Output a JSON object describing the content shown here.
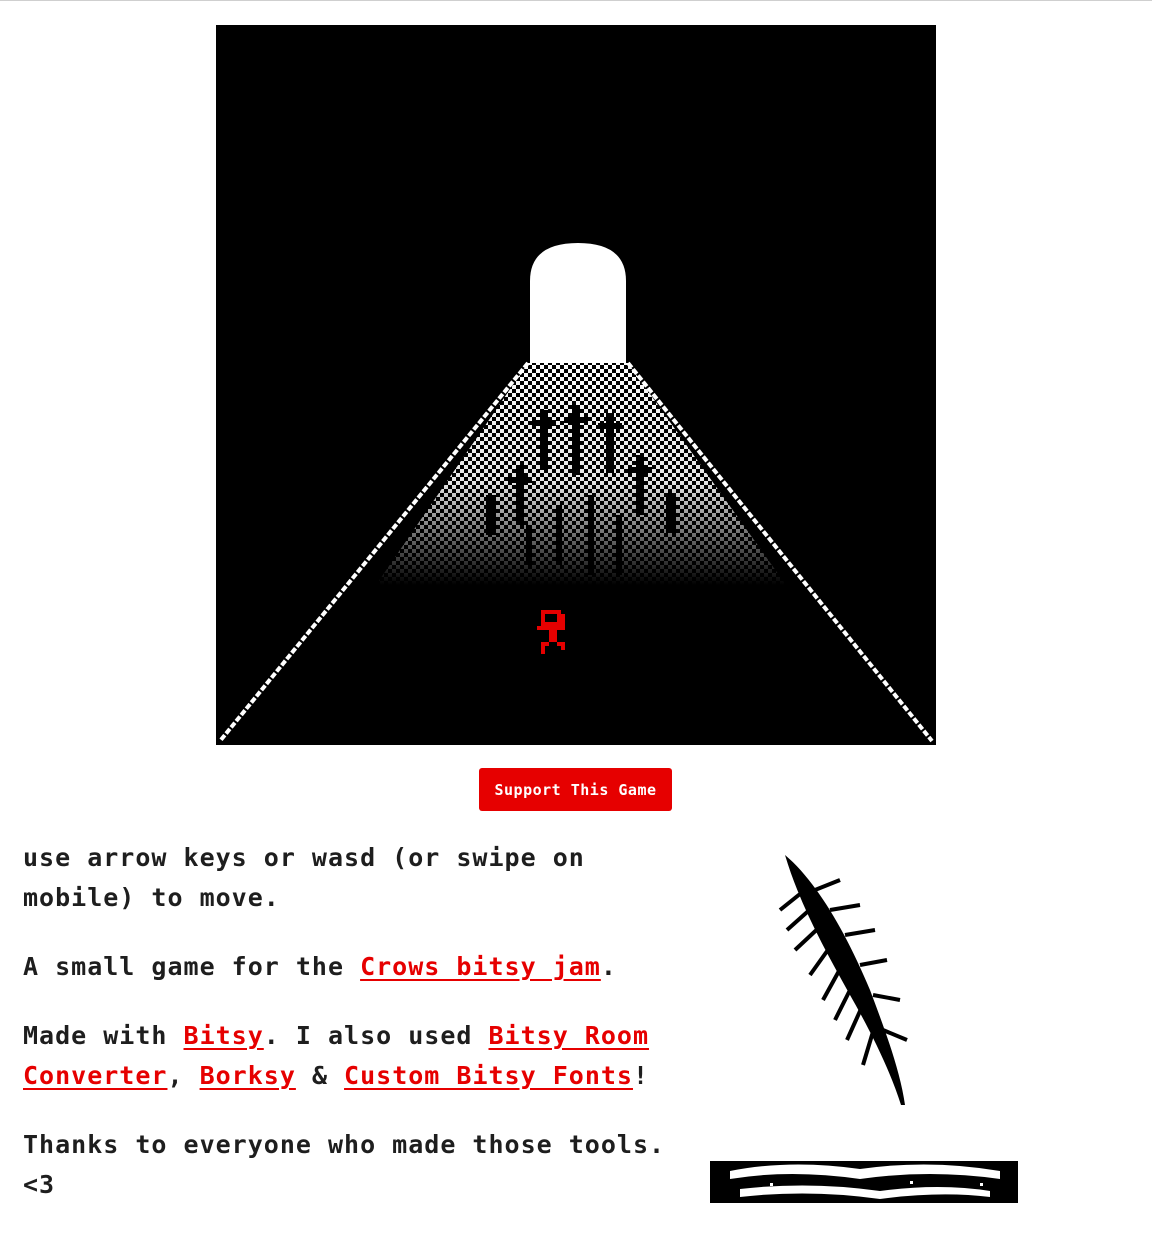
{
  "button": {
    "support_label": "Support This Game"
  },
  "description": {
    "line1": "use arrow keys or wasd (or swipe on mobile) to move.",
    "p2_prefix": "A small game for the ",
    "p2_link": "Crows bitsy jam",
    "p2_suffix": ".",
    "p3_prefix": "Made with ",
    "p3_link1": "Bitsy",
    "p3_mid1": ". I also used ",
    "p3_link2": "Bitsy Room Converter",
    "p3_sep1": ", ",
    "p3_link3": "Borksy",
    "p3_sep2": " & ",
    "p3_link4": "Custom Bitsy Fonts",
    "p3_suffix": "!",
    "p4": "Thanks to everyone who made those tools. <3"
  },
  "colors": {
    "accent": "#e60000",
    "game_bg": "#000000",
    "page_bg": "#ffffff"
  },
  "icons": {
    "feather": "feather-icon",
    "character": "player-sprite",
    "scroll": "scroll-art"
  }
}
